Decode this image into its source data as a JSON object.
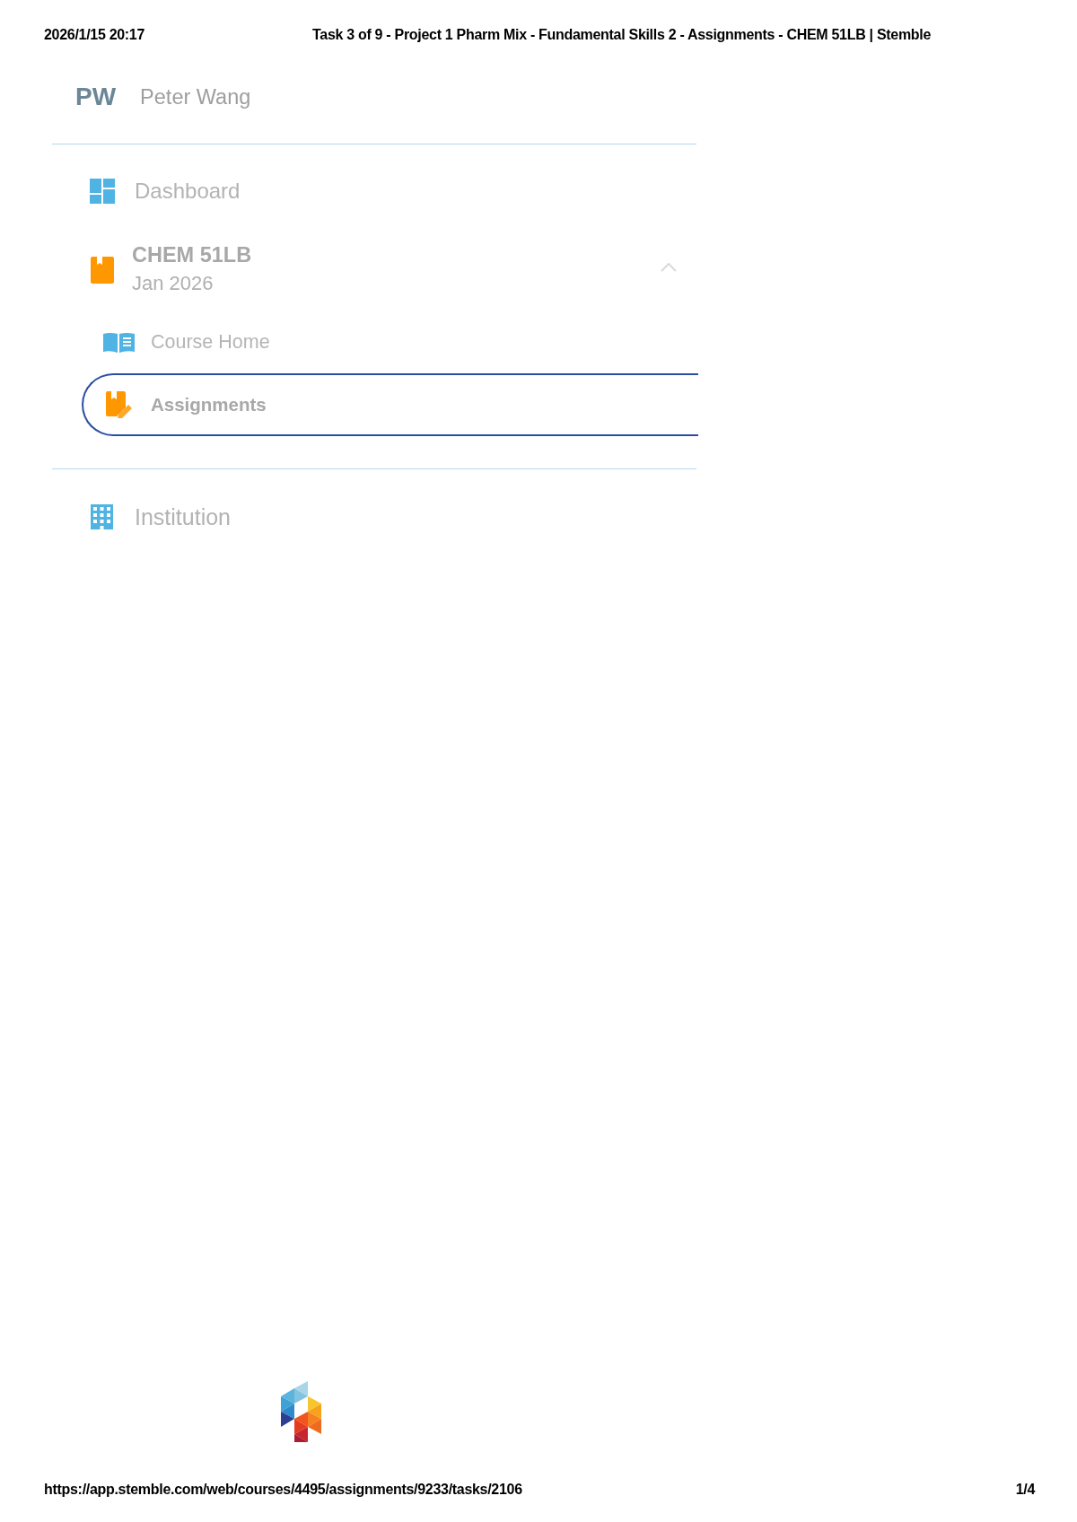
{
  "print_header": {
    "date": "2026/1/15 20:17",
    "title": "Task 3 of 9 - Project 1 Pharm Mix - Fundamental Skills 2 - Assignments - CHEM 51LB | Stemble"
  },
  "sidebar": {
    "user": {
      "initials": "PW",
      "name": "Peter Wang"
    },
    "dashboard": {
      "label": "Dashboard"
    },
    "course": {
      "title": "CHEM 51LB",
      "term": "Jan 2026",
      "expanded": true,
      "children": [
        {
          "label": "Course Home",
          "selected": false
        },
        {
          "label": "Assignments",
          "selected": true
        }
      ]
    },
    "institution": {
      "label": "Institution"
    }
  },
  "print_footer": {
    "url": "https://app.stemble.com/web/courses/4495/assignments/9233/tasks/2106",
    "page": "1/4"
  }
}
